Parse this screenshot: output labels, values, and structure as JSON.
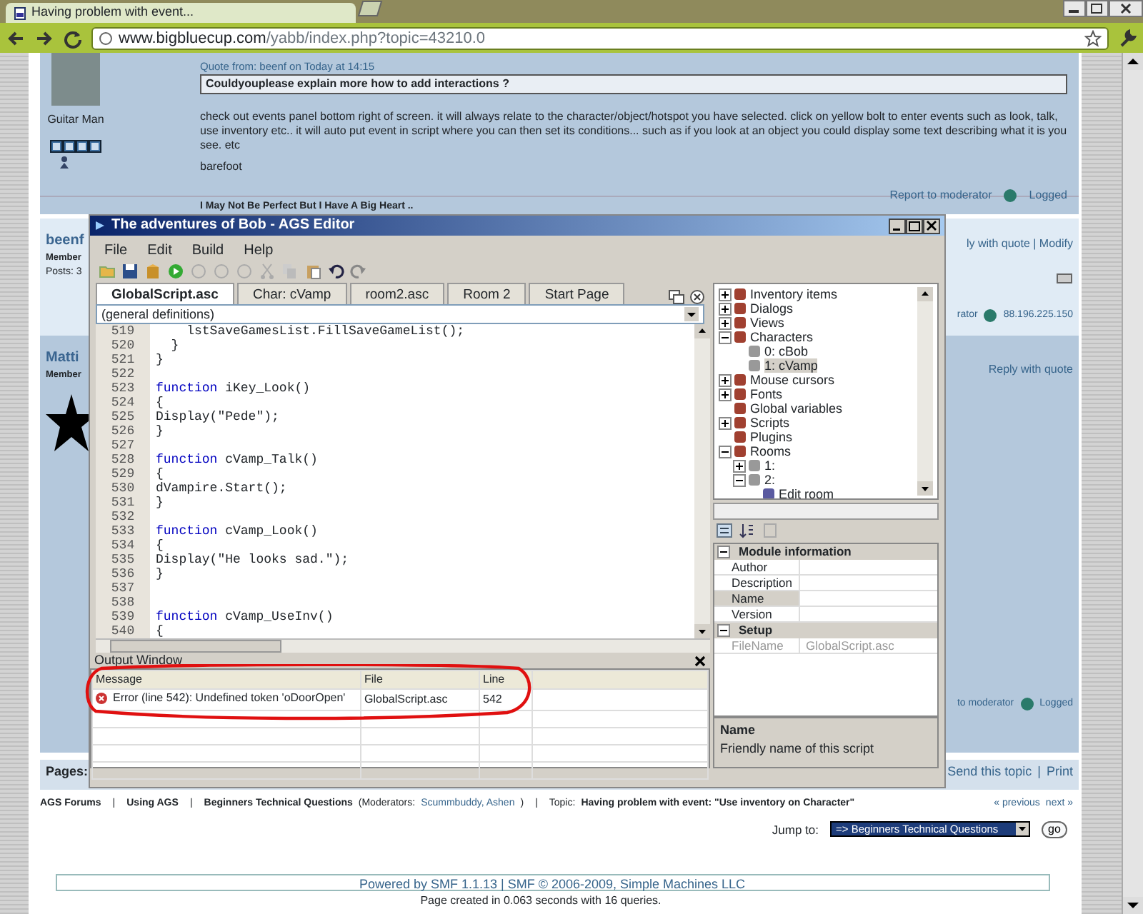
{
  "browser": {
    "tab_title": "Having problem with event...",
    "url_host": "www.bigbluecup.com",
    "url_path": "/yabb/index.php?topic=43210.0"
  },
  "posts": [
    {
      "author": "Guitar Man",
      "quote_header": "Quote from: beenf on Today at 14:15",
      "quote": "Couldyouplease explain more how to add interactions ?",
      "body": "check out events panel bottom right of screen. it will always relate to the character/object/hotspot you have selected. click on yellow bolt to enter events such as look, talk, use inventory etc.. it will auto put event in script where you can then set its conditions... such as if you look at an object you could display some text describing what it is you see.  etc",
      "signoff": "barefoot",
      "footer": [
        "Report to moderator",
        "Logged"
      ],
      "signature": "I May Not Be Perfect But I Have A Big Heart .."
    },
    {
      "author": "beenf",
      "rank": "Member",
      "posts": "Posts: 3",
      "links": "ly with quote | Modify",
      "footer": [
        "rator",
        "88.196.225.150"
      ]
    },
    {
      "author": "Matti",
      "rank": "Member",
      "links": "Reply with quote",
      "footer": [
        "to moderator",
        "Logged"
      ]
    }
  ],
  "pages_bar": {
    "label": "Pages:",
    "links": [
      "Send this topic",
      "Print"
    ],
    "separator": "|"
  },
  "breadcrumb": [
    {
      "kind": "link",
      "text": "AGS Forums"
    },
    {
      "kind": "sep",
      "text": "|"
    },
    {
      "kind": "link",
      "text": "Using AGS"
    },
    {
      "kind": "sep",
      "text": "|"
    },
    {
      "kind": "link",
      "text": "Beginners Technical Questions"
    },
    {
      "kind": "plain",
      "text": "(Moderators:"
    },
    {
      "kind": "mod",
      "text": "Scummbuddy, Ashen"
    },
    {
      "kind": "plain",
      "text": ")"
    },
    {
      "kind": "sep",
      "text": "|"
    },
    {
      "kind": "plain",
      "text": "Topic:"
    },
    {
      "kind": "link",
      "text": "Having problem with event: \"Use inventory on Character\""
    }
  ],
  "topic_nav": [
    "« previous",
    "next »"
  ],
  "jump": {
    "label": "Jump to:",
    "value": "=> Beginners Technical Questions",
    "button": "go"
  },
  "footer": {
    "powered": "Powered by SMF 1.1.13 | SMF © 2006-2009, Simple Machines LLC",
    "stats": "Page created in 0.063 seconds with 16 queries."
  },
  "editor": {
    "title": "The adventures of Bob - AGS Editor",
    "menu": [
      "File",
      "Edit",
      "Build",
      "Help"
    ],
    "tabs": [
      {
        "label": "GlobalScript.asc",
        "selected": true
      },
      {
        "label": "Char: cVamp",
        "selected": false
      },
      {
        "label": "room2.asc",
        "selected": false
      },
      {
        "label": "Room 2",
        "selected": false
      },
      {
        "label": "Start Page",
        "selected": false
      }
    ],
    "function_dropdown": "(general definitions)",
    "code": [
      {
        "num": "519",
        "text": "    lstSaveGamesList.FillSaveGameList();"
      },
      {
        "num": "520",
        "text": "  }"
      },
      {
        "num": "521",
        "text": "}"
      },
      {
        "num": "522"
      },
      {
        "num": "523",
        "keyword": "function",
        "text": "iKey_Look()"
      },
      {
        "num": "524",
        "text": "{"
      },
      {
        "num": "525",
        "text": "Display(\"Pede\");"
      },
      {
        "num": "526",
        "text": "}"
      },
      {
        "num": "527"
      },
      {
        "num": "528",
        "keyword": "function",
        "text": "cVamp_Talk()"
      },
      {
        "num": "529",
        "text": "{"
      },
      {
        "num": "530",
        "text": "dVampire.Start();"
      },
      {
        "num": "531",
        "text": "}"
      },
      {
        "num": "532"
      },
      {
        "num": "533",
        "keyword": "function",
        "text": "cVamp_Look()"
      },
      {
        "num": "534",
        "text": "{"
      },
      {
        "num": "535",
        "text": "Display(\"He looks sad.\");"
      },
      {
        "num": "536",
        "text": "}"
      },
      {
        "num": "537"
      },
      {
        "num": "538"
      },
      {
        "num": "539",
        "keyword": "function",
        "text": "cVamp_UseInv()"
      },
      {
        "num": "540",
        "text": "{"
      }
    ],
    "output": {
      "title": "Output Window",
      "columns": [
        "Message",
        "File",
        "Line"
      ],
      "rows": [
        {
          "message": "Error (line 542): Undefined token 'oDoorOpen'",
          "file": "GlobalScript.asc",
          "line": "542"
        }
      ]
    },
    "tree": [
      {
        "label": "Inventory items",
        "expanded": false,
        "selected": false
      },
      {
        "label": "Dialogs",
        "expanded": false,
        "selected": false
      },
      {
        "label": "Views",
        "expanded": false,
        "selected": false
      },
      {
        "label": "Characters",
        "expanded": true,
        "selected": false,
        "children": [
          {
            "label": "0: cBob",
            "selected": false
          },
          {
            "label": "1: cVamp",
            "selected": true
          }
        ]
      },
      {
        "label": "Mouse cursors",
        "expanded": false,
        "selected": false
      },
      {
        "label": "Fonts",
        "expanded": false,
        "selected": false
      },
      {
        "label": "Global variables",
        "selected": false
      },
      {
        "label": "Scripts",
        "expanded": false,
        "selected": false
      },
      {
        "label": "Plugins",
        "selected": false
      },
      {
        "label": "Rooms",
        "expanded": true,
        "selected": false,
        "children": [
          {
            "label": "1:",
            "expanded": false,
            "selected": false
          },
          {
            "label": "2:",
            "expanded": true,
            "selected": false,
            "children": [
              {
                "label": "Edit room",
                "selected": false
              }
            ]
          }
        ]
      }
    ],
    "properties": [
      {
        "category": "Module information",
        "expanded": true,
        "rows": [
          {
            "name": "Author",
            "selected": false,
            "disabled": false
          },
          {
            "name": "Description",
            "selected": false,
            "disabled": false
          },
          {
            "name": "Name",
            "selected": true,
            "disabled": false
          },
          {
            "name": "Version",
            "selected": false,
            "disabled": false
          }
        ]
      },
      {
        "category": "Setup",
        "expanded": true,
        "rows": [
          {
            "name": "FileName",
            "value": "GlobalScript.asc",
            "selected": false,
            "disabled": true
          }
        ]
      }
    ],
    "description": {
      "title": "Name",
      "text": "Friendly name of this script"
    }
  }
}
